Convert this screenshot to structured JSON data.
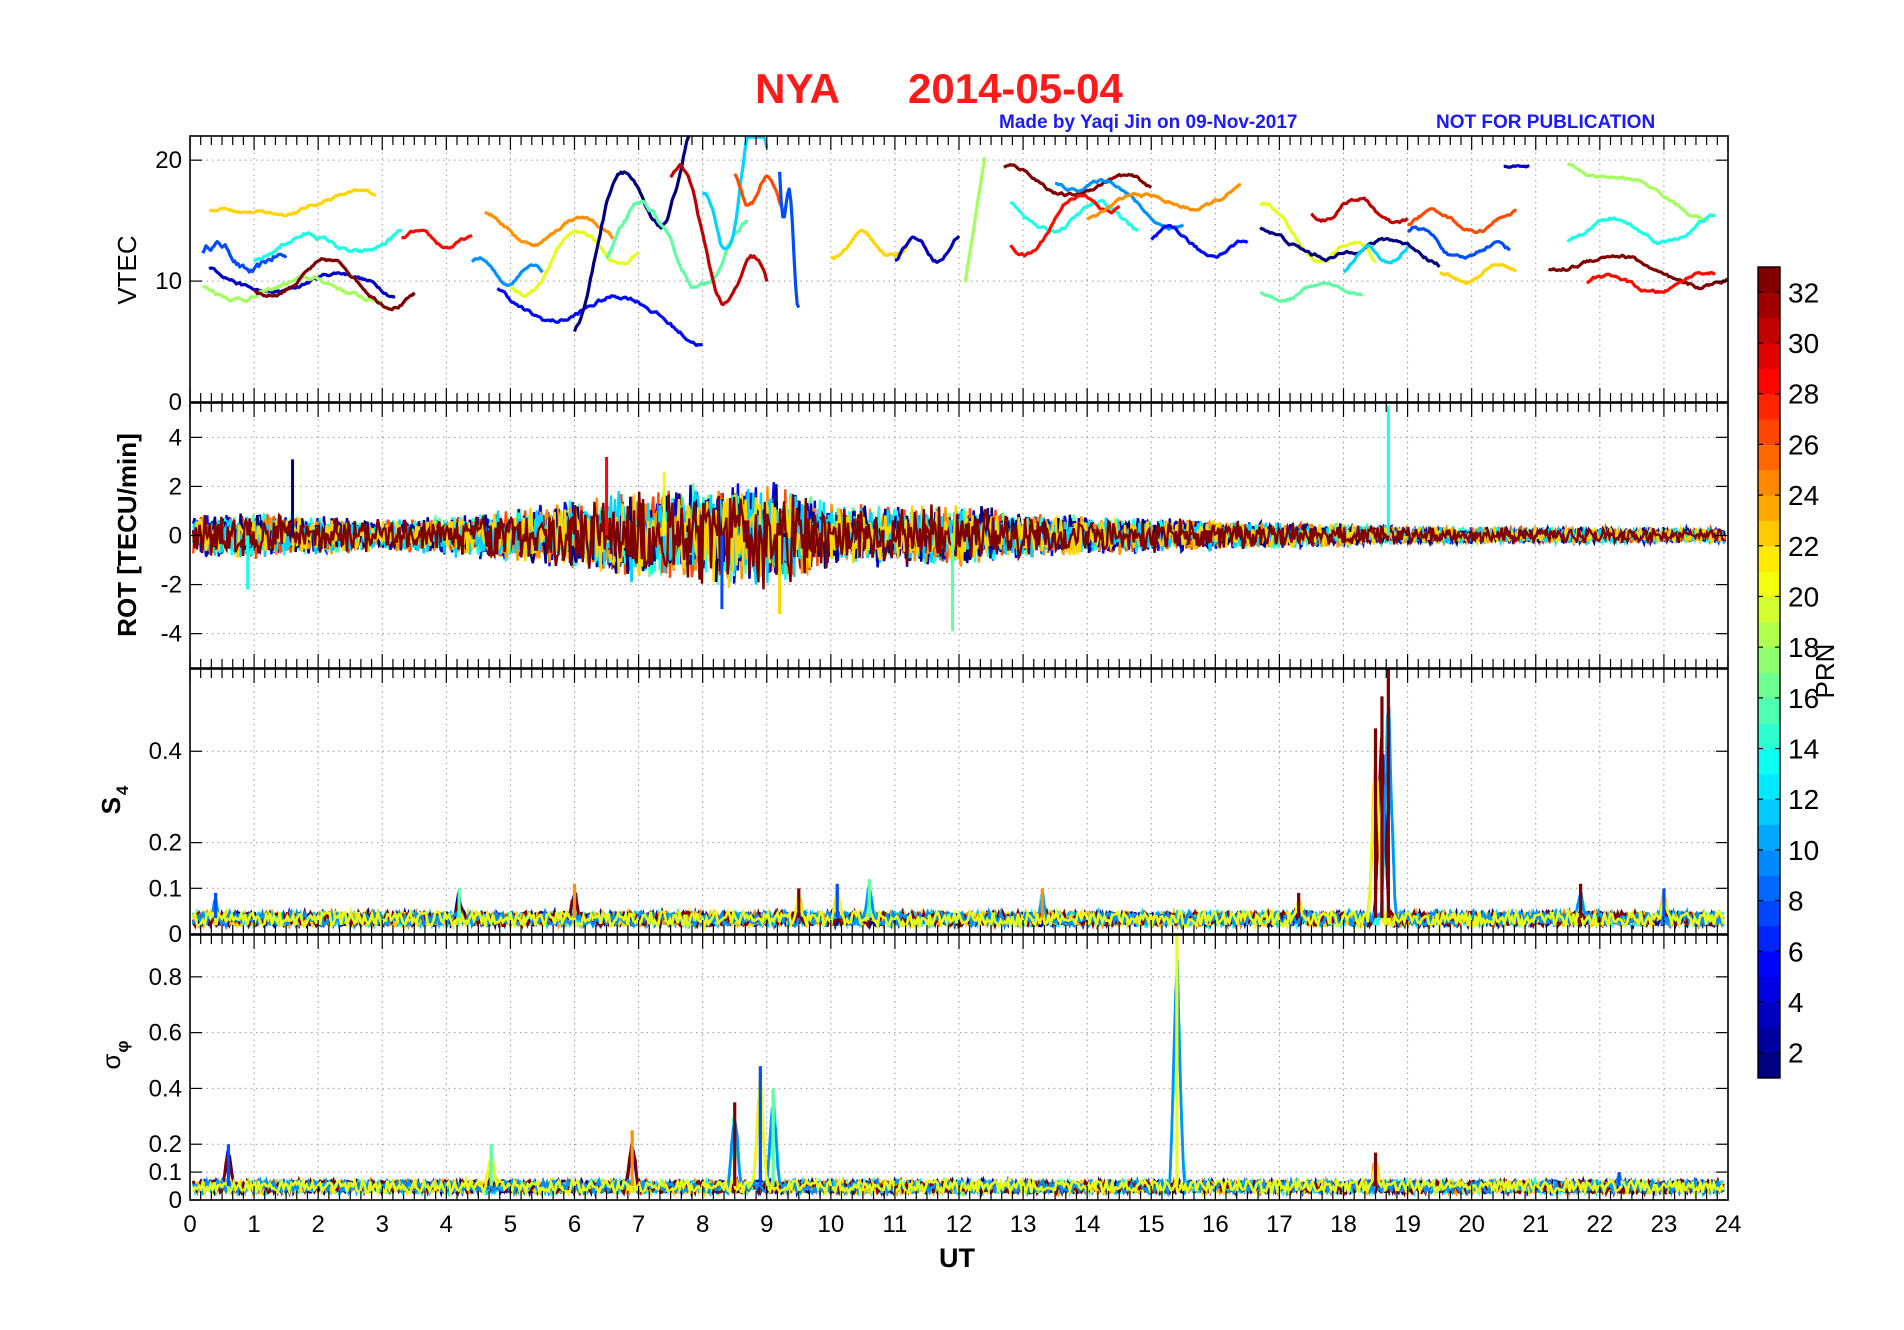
{
  "figure": {
    "station": "NYA",
    "date": "2014-05-04",
    "credit": "Made by Yaqi Jin on 09-Nov-2017",
    "notice": "NOT FOR PUBLICATION",
    "title_color": "#ff1a1a",
    "note_color": "#1a1aff"
  },
  "chart_data": [
    {
      "type": "line",
      "ylabel": "VTEC",
      "xlabel": "",
      "xlim": [
        0,
        24
      ],
      "ylim": [
        0,
        22
      ],
      "yticks": [
        0,
        10,
        20
      ],
      "grid": true,
      "series_shape": [
        [
          0.2,
          1.5,
          12.5,
          11,
          0.9,
          1.5
        ],
        [
          0.3,
          2.9,
          15.4,
          17,
          0.5,
          0.7
        ],
        [
          0.3,
          3.2,
          10.2,
          9.5,
          1.0,
          0.8
        ],
        [
          0.2,
          3.0,
          9.5,
          9.2,
          0.8,
          0.9
        ],
        [
          1.0,
          3.5,
          10.5,
          9.5,
          1.5,
          0.8
        ],
        [
          1.0,
          3.3,
          12.5,
          13.5,
          1.0,
          0.9
        ],
        [
          3.3,
          4.4,
          13.6,
          13.0,
          0.5,
          0.7
        ],
        [
          4.4,
          5.5,
          11.0,
          10.5,
          1.0,
          0.6
        ],
        [
          4.6,
          6.6,
          14.5,
          14.0,
          1.2,
          0.7
        ],
        [
          4.8,
          8.0,
          8.8,
          6.3,
          1.5,
          0.9
        ],
        [
          5.0,
          7.0,
          10.5,
          13.8,
          2.0,
          0.9
        ],
        [
          6.0,
          7.8,
          10.5,
          21.5,
          4.5,
          1.2
        ],
        [
          6.5,
          8.7,
          13.5,
          12.0,
          3.0,
          1.1
        ],
        [
          7.5,
          9.0,
          17.0,
          7.0,
          3.5,
          1.2
        ],
        [
          8.0,
          9.0,
          13.0,
          21.5,
          4.0,
          1.3
        ],
        [
          8.5,
          9.3,
          18.0,
          17.0,
          1.5,
          1.0
        ],
        [
          9.2,
          9.5,
          20.0,
          10.0,
          3.0,
          1.4
        ],
        [
          10.0,
          11.2,
          13.0,
          13.0,
          1.0,
          0.9
        ],
        [
          11.0,
          12.0,
          12.5,
          13.0,
          1.0,
          0.8
        ],
        [
          12.1,
          12.4,
          10.0,
          20.2,
          0.0,
          1.0
        ],
        [
          12.7,
          15.0,
          18.5,
          17.5,
          1.0,
          0.7
        ],
        [
          12.8,
          14.8,
          15.5,
          15.0,
          1.2,
          0.8
        ],
        [
          12.8,
          14.5,
          13.0,
          17.5,
          1.5,
          0.8
        ],
        [
          13.5,
          15.5,
          19.0,
          15.0,
          1.0,
          0.7
        ],
        [
          14.0,
          16.4,
          15.8,
          17.2,
          0.8,
          0.7
        ],
        [
          15.0,
          16.5,
          13.5,
          12.5,
          0.8,
          0.8
        ],
        [
          16.7,
          18.5,
          15.2,
          11.0,
          1.5,
          0.8
        ],
        [
          16.7,
          19.5,
          13.5,
          12.0,
          1.0,
          0.8
        ],
        [
          16.7,
          18.3,
          8.8,
          9.5,
          0.5,
          0.6
        ],
        [
          17.5,
          19.0,
          16.2,
          15.5,
          1.0,
          0.8
        ],
        [
          18.0,
          19.0,
          11.5,
          12.5,
          0.8,
          0.8
        ],
        [
          19.0,
          20.7,
          15.0,
          15.0,
          0.8,
          0.7
        ],
        [
          19.0,
          20.6,
          13.5,
          12.0,
          1.0,
          0.8
        ],
        [
          19.5,
          20.7,
          10.2,
          11.0,
          0.5,
          0.6
        ],
        [
          20.5,
          20.9,
          19.5,
          19.5,
          0.0,
          0.4
        ],
        [
          21.5,
          23.7,
          20.0,
          15.5,
          0.5,
          0.6
        ],
        [
          21.2,
          24.0,
          12.0,
          10.0,
          1.0,
          0.8
        ],
        [
          21.5,
          23.8,
          14.0,
          14.5,
          1.0,
          0.8
        ],
        [
          21.8,
          23.8,
          9.5,
          10.0,
          0.8,
          0.7
        ]
      ]
    },
    {
      "type": "line",
      "ylabel": "ROT [TECU/min]",
      "xlim": [
        0,
        24
      ],
      "ylim": [
        -5.4,
        5.4
      ],
      "yticks": [
        -4,
        -2,
        0,
        2,
        4
      ],
      "grid": true,
      "amplitude_envelope": [
        [
          0,
          0.8
        ],
        [
          1,
          0.9
        ],
        [
          2,
          0.8
        ],
        [
          3,
          0.6
        ],
        [
          4,
          0.8
        ],
        [
          5,
          1.0
        ],
        [
          6,
          1.4
        ],
        [
          7,
          1.8
        ],
        [
          8,
          2.0
        ],
        [
          9,
          2.2
        ],
        [
          10,
          1.2
        ],
        [
          11,
          1.2
        ],
        [
          12,
          1.3
        ],
        [
          13,
          0.9
        ],
        [
          14,
          0.8
        ],
        [
          15,
          0.7
        ],
        [
          16,
          0.6
        ],
        [
          17,
          0.5
        ],
        [
          18,
          0.5
        ],
        [
          19,
          0.35
        ],
        [
          20,
          0.35
        ],
        [
          24,
          0.3
        ]
      ],
      "spikes": [
        [
          18.7,
          5.3
        ],
        [
          11.9,
          -3.9
        ],
        [
          9.2,
          -3.2
        ],
        [
          6.5,
          3.2
        ],
        [
          1.6,
          3.1
        ],
        [
          8.3,
          -3.0
        ],
        [
          0.9,
          -2.2
        ],
        [
          7.4,
          2.6
        ]
      ]
    },
    {
      "type": "line",
      "ylabel": "S4",
      "xlim": [
        0,
        24
      ],
      "ylim": [
        0,
        0.58
      ],
      "yticks": [
        0,
        0.1,
        0.2,
        0.4
      ],
      "grid": true,
      "baseline": 0.035,
      "bursts": [
        [
          0.4,
          0.09
        ],
        [
          4.2,
          0.1
        ],
        [
          6.0,
          0.11
        ],
        [
          9.5,
          0.1
        ],
        [
          10.1,
          0.11
        ],
        [
          10.6,
          0.12
        ],
        [
          13.3,
          0.1
        ],
        [
          17.3,
          0.09
        ],
        [
          18.5,
          0.45
        ],
        [
          18.6,
          0.52
        ],
        [
          18.7,
          0.58
        ],
        [
          21.7,
          0.11
        ],
        [
          23.0,
          0.1
        ]
      ]
    },
    {
      "type": "line",
      "ylabel": "σφ",
      "xlabel": "UT",
      "xlim": [
        0,
        24
      ],
      "ylim": [
        0,
        0.95
      ],
      "yticks": [
        0,
        0.1,
        0.2,
        0.4,
        0.6,
        0.8
      ],
      "xticks": [
        0,
        1,
        2,
        3,
        4,
        5,
        6,
        7,
        8,
        9,
        10,
        11,
        12,
        13,
        14,
        15,
        16,
        17,
        18,
        19,
        20,
        21,
        22,
        23,
        24
      ],
      "grid": true,
      "baseline": 0.05,
      "bursts": [
        [
          0.6,
          0.2
        ],
        [
          4.7,
          0.2
        ],
        [
          6.9,
          0.25
        ],
        [
          8.5,
          0.35
        ],
        [
          8.9,
          0.48
        ],
        [
          9.1,
          0.4
        ],
        [
          15.4,
          0.95
        ],
        [
          18.5,
          0.17
        ],
        [
          22.3,
          0.1
        ]
      ]
    }
  ],
  "colorbar": {
    "label": "PRN",
    "min": 1,
    "max": 33,
    "ticks": [
      2,
      4,
      6,
      8,
      10,
      12,
      14,
      16,
      18,
      20,
      22,
      24,
      26,
      28,
      30,
      32
    ],
    "colormap": "jet"
  }
}
